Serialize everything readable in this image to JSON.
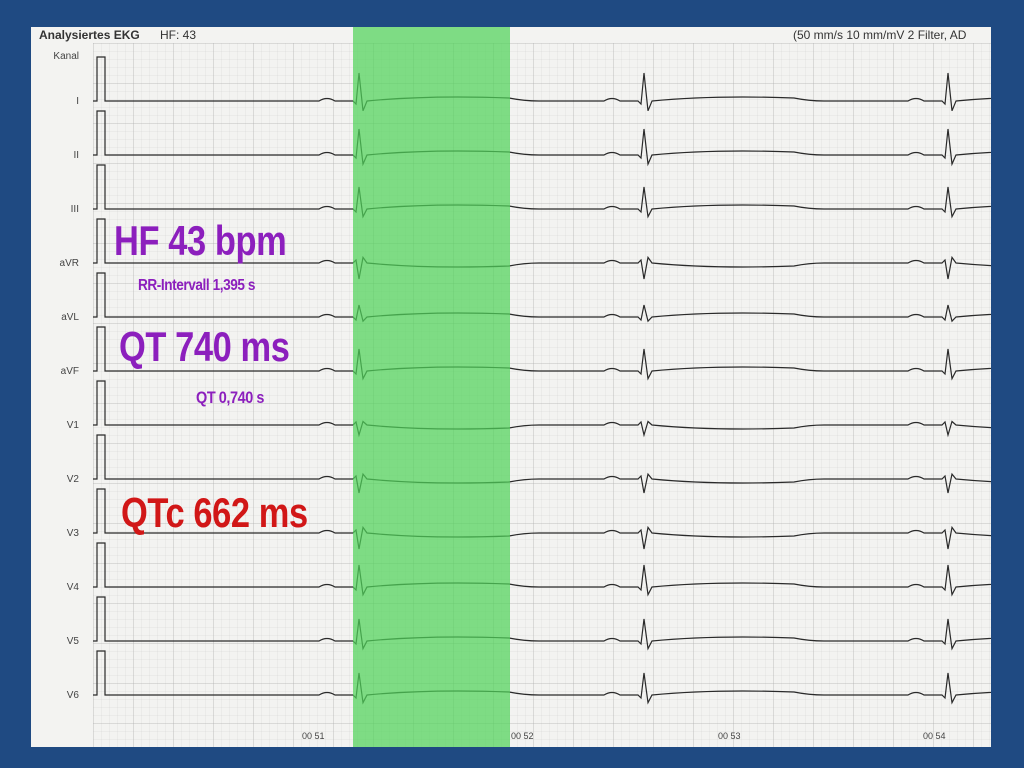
{
  "header": {
    "title": "Analysiertes EKG",
    "hf": "HF:  43",
    "settings": "(50 mm/s  10 mm/mV   2 Filter, AD"
  },
  "leads": {
    "column_label": "Kanal",
    "names": [
      "I",
      "II",
      "III",
      "aVR",
      "aVL",
      "aVF",
      "V1",
      "V2",
      "V3",
      "V4",
      "V5",
      "V6"
    ]
  },
  "annotations": {
    "hf": "HF 43 bpm",
    "rr": "RR-Intervall 1,395 s",
    "qt": "QT 740 ms",
    "qt_seconds": "QT 0,740 s",
    "qtc": "QTc 662 ms"
  },
  "time_markers": [
    "00 51",
    "00 52",
    "00 53",
    "00 54"
  ],
  "colors": {
    "frame": "#1f4a82",
    "highlight": "#50d25a",
    "annotation_purple": "#8c1fbd",
    "annotation_red": "#d11717"
  }
}
